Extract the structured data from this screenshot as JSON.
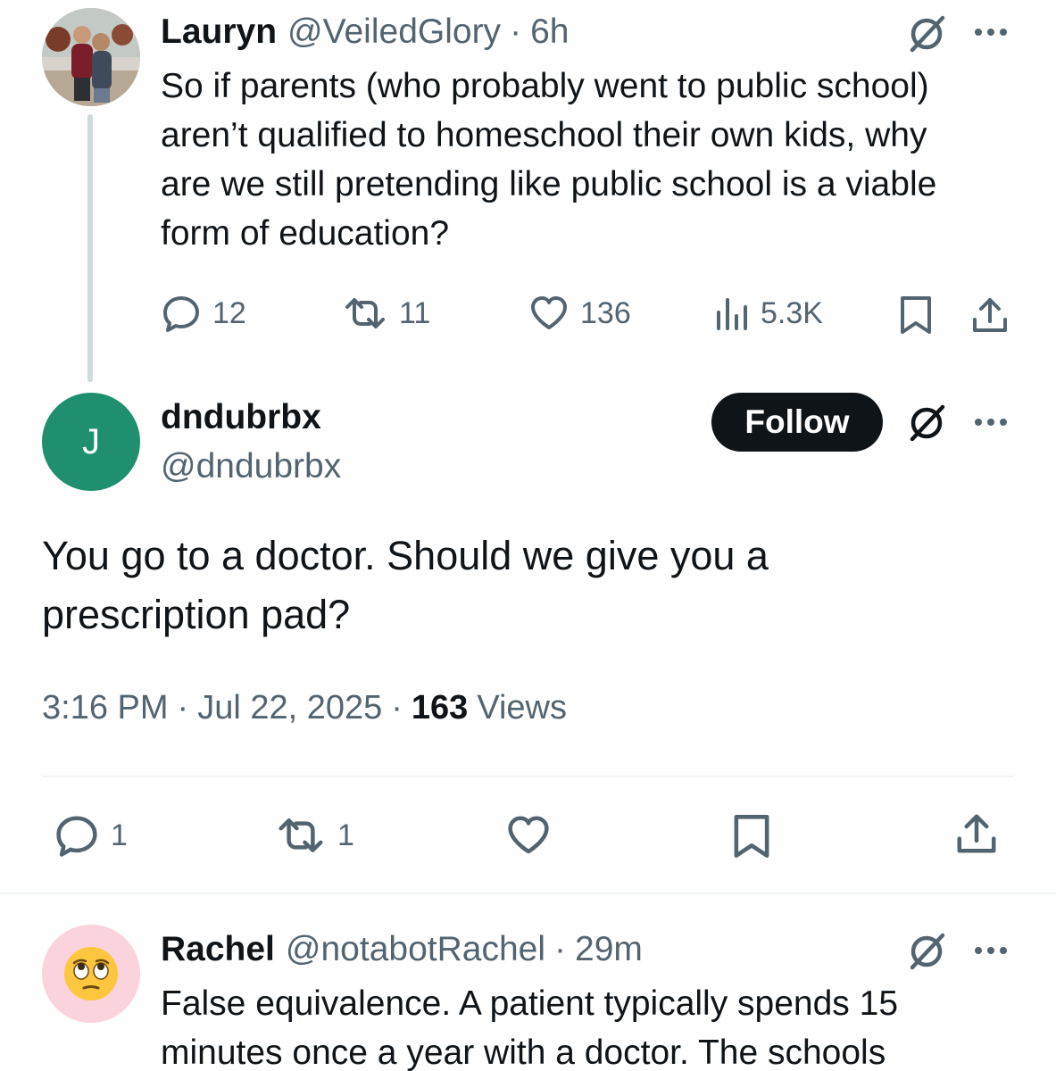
{
  "tweet1": {
    "name": "Lauryn",
    "handle": "@VeiledGlory",
    "sep": "·",
    "time": "6h",
    "lines": [
      "So if parents (who probably went to public school)",
      "aren’t qualified to homeschool their own kids, why",
      "are we still pretending like public school is a viable",
      "form of education?"
    ],
    "replies": "12",
    "reposts": "11",
    "likes": "136",
    "views": "5.3K"
  },
  "tweet2": {
    "avatar_letter": "J",
    "name": "dndubrbx",
    "handle": "@dndubrbx",
    "follow_label": "Follow",
    "lines": [
      "You go to a doctor. Should we give you a",
      "prescription pad?"
    ],
    "time": "3:16 PM",
    "sep": "·",
    "date": "Jul 22, 2025",
    "sep2": "·",
    "views_count": "163",
    "views_label": "Views",
    "replies": "1",
    "reposts": "1"
  },
  "tweet3": {
    "name": "Rachel",
    "handle": "@notabotRachel",
    "sep": "·",
    "time": "29m",
    "lines": [
      "False equivalence. A patient typically spends 15",
      "minutes once a year with a doctor. The schools"
    ]
  },
  "colors": {
    "text": "#0f1419",
    "muted": "#536471",
    "green_avatar": "#1f8f6f",
    "pink_avatar": "#fbd3dc",
    "line": "#cfd9de"
  },
  "icons": [
    "grok-icon",
    "more-icon",
    "reply-icon",
    "repost-icon",
    "like-icon",
    "views-icon",
    "bookmark-icon",
    "share-icon",
    "rolling-eyes-emoji"
  ]
}
